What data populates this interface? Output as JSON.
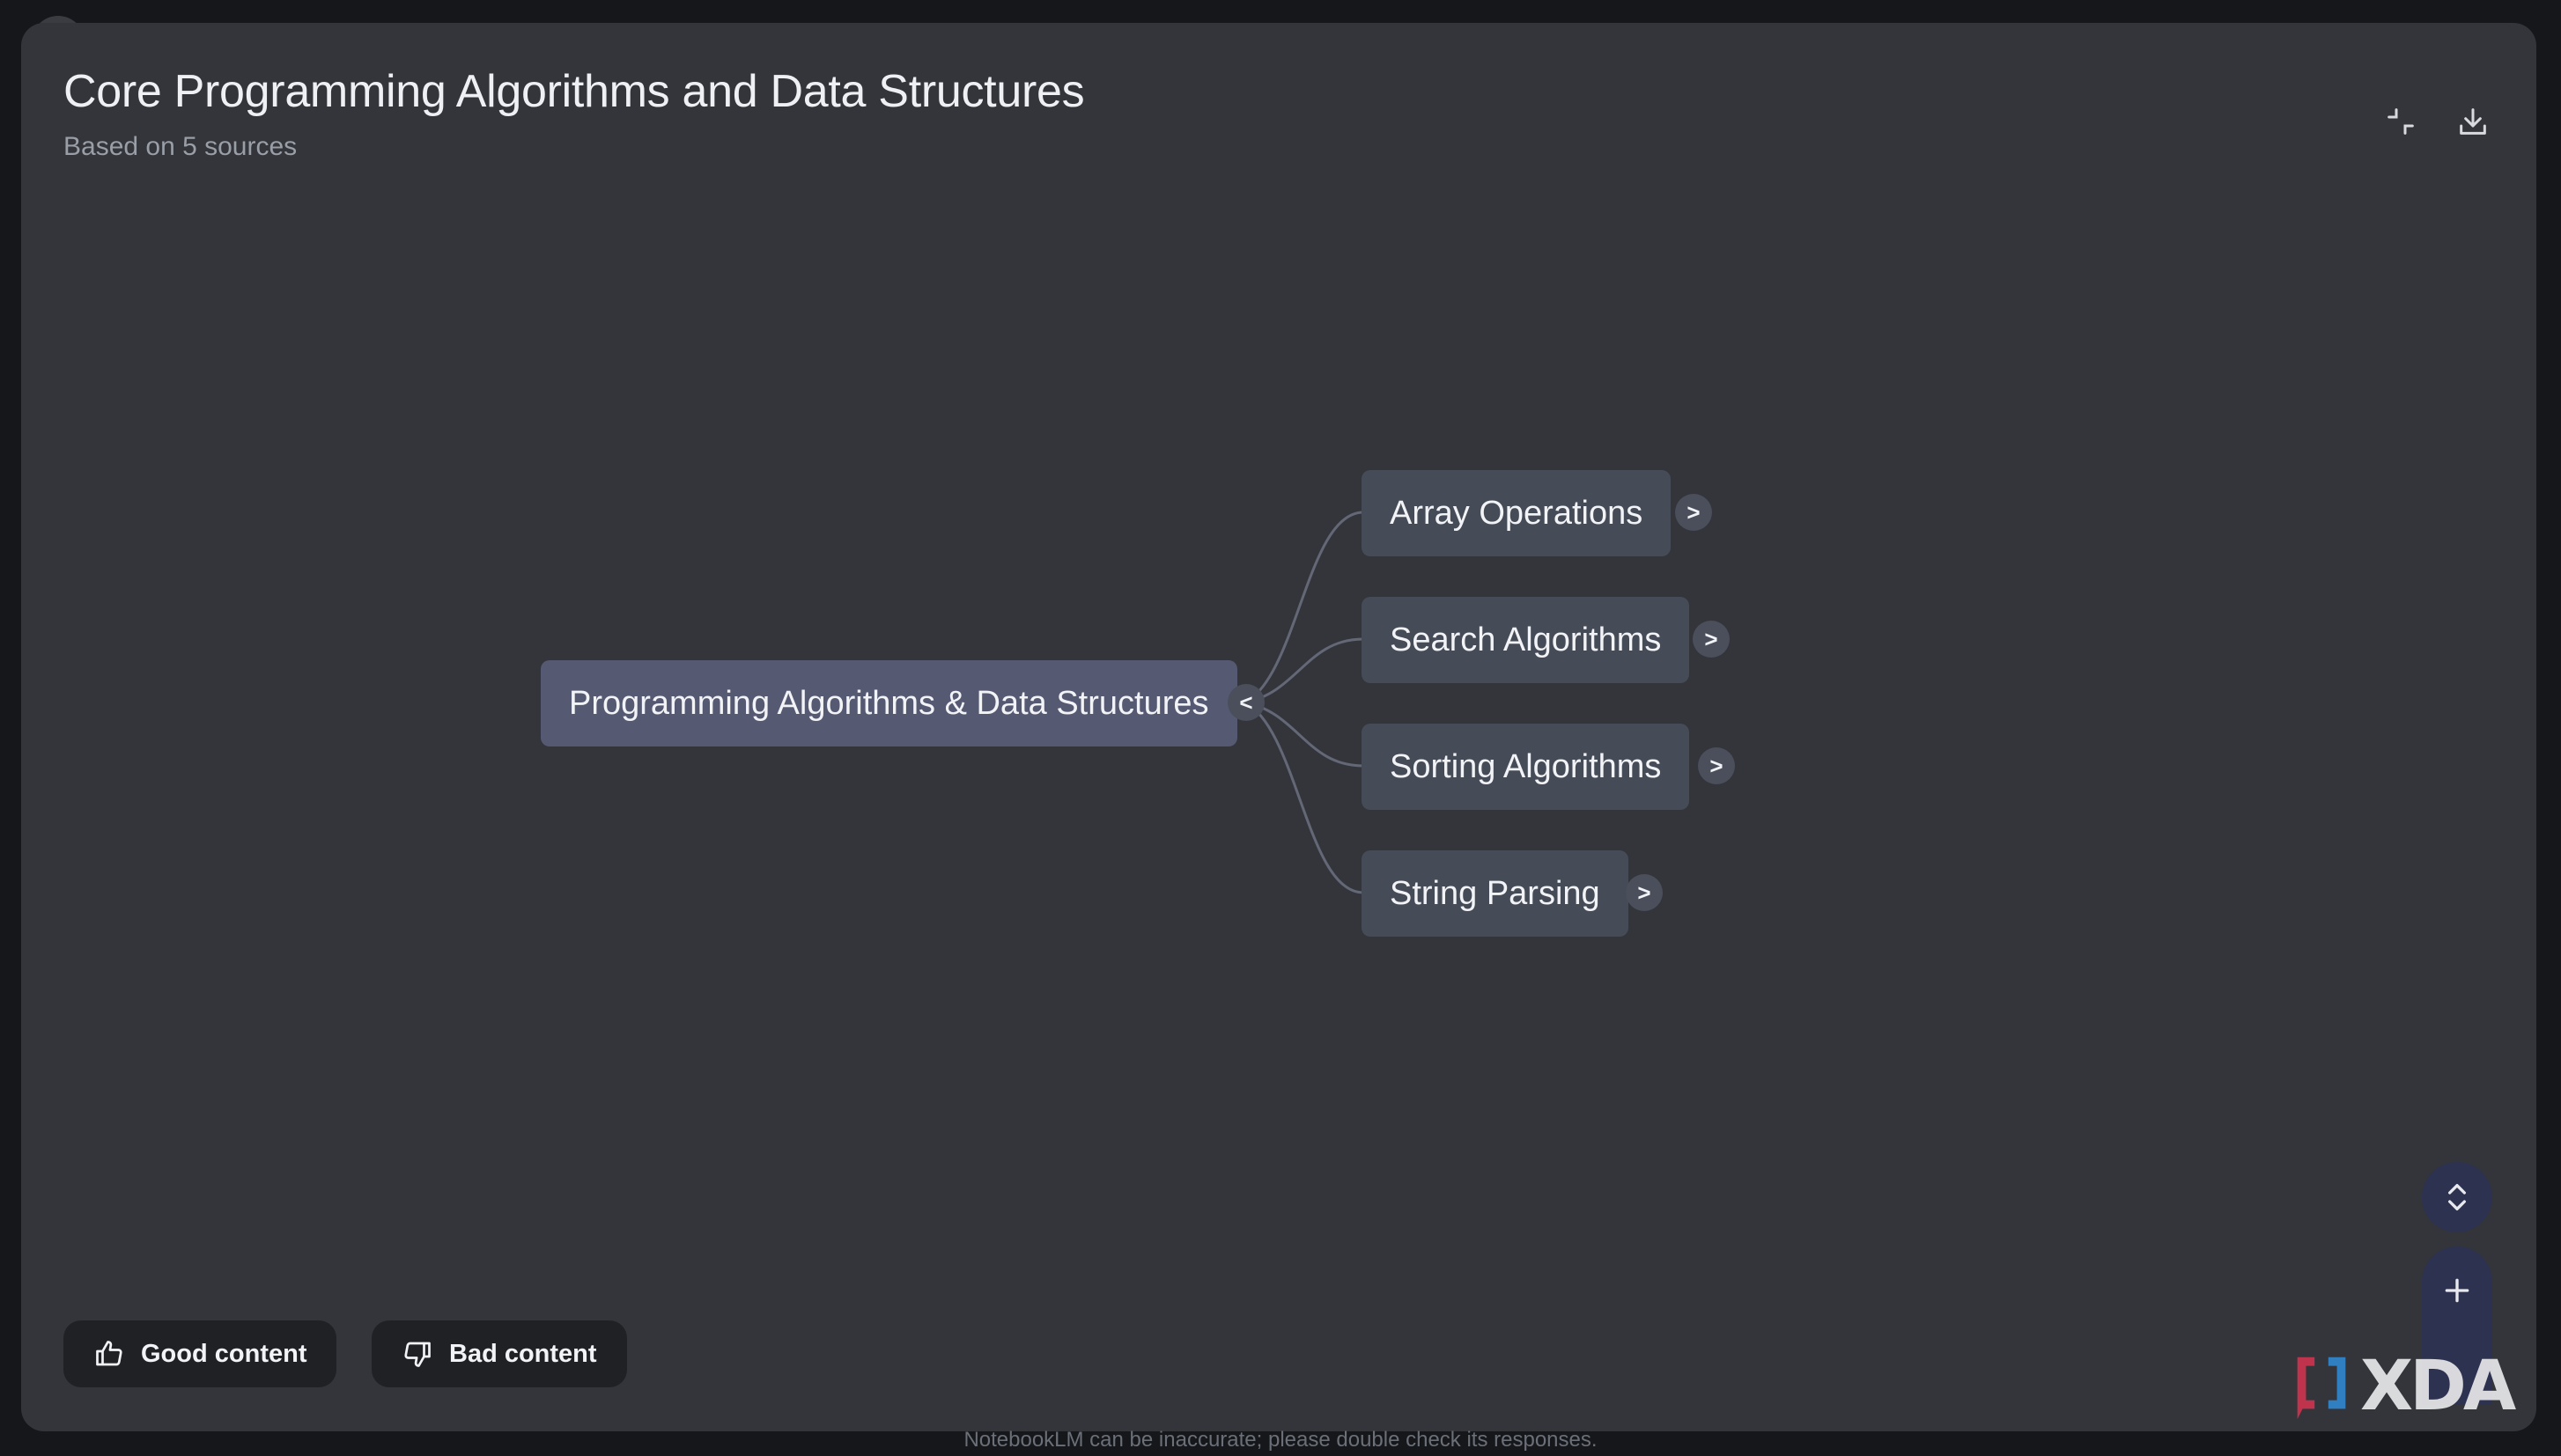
{
  "header": {
    "title": "Core Programming Algorithms and Data Structures",
    "subtitle": "Based on 5 sources",
    "collapse_icon": "collapse-icon",
    "download_icon": "download-icon"
  },
  "mindmap": {
    "root": {
      "label": "Programming Algorithms & Data Structures",
      "toggle": "<"
    },
    "children": [
      {
        "label": "Array Operations",
        "toggle": ">"
      },
      {
        "label": "Search Algorithms",
        "toggle": ">"
      },
      {
        "label": "Sorting Algorithms",
        "toggle": ">"
      },
      {
        "label": "String Parsing",
        "toggle": ">"
      }
    ],
    "edge_color": "#646876"
  },
  "feedback": {
    "good_label": "Good content",
    "bad_label": "Bad content"
  },
  "zoom": {
    "fit_icon": "expand-collapse-icon",
    "zoom_in_icon": "plus-icon"
  },
  "footer": {
    "disclaimer": "NotebookLM can be inaccurate; please double check its responses."
  },
  "watermark": {
    "text": "XDA"
  },
  "colors": {
    "panel": "#33353b",
    "root_node": "#555972",
    "child_node": "#454b57",
    "zoom_controls": "#2d3250"
  }
}
